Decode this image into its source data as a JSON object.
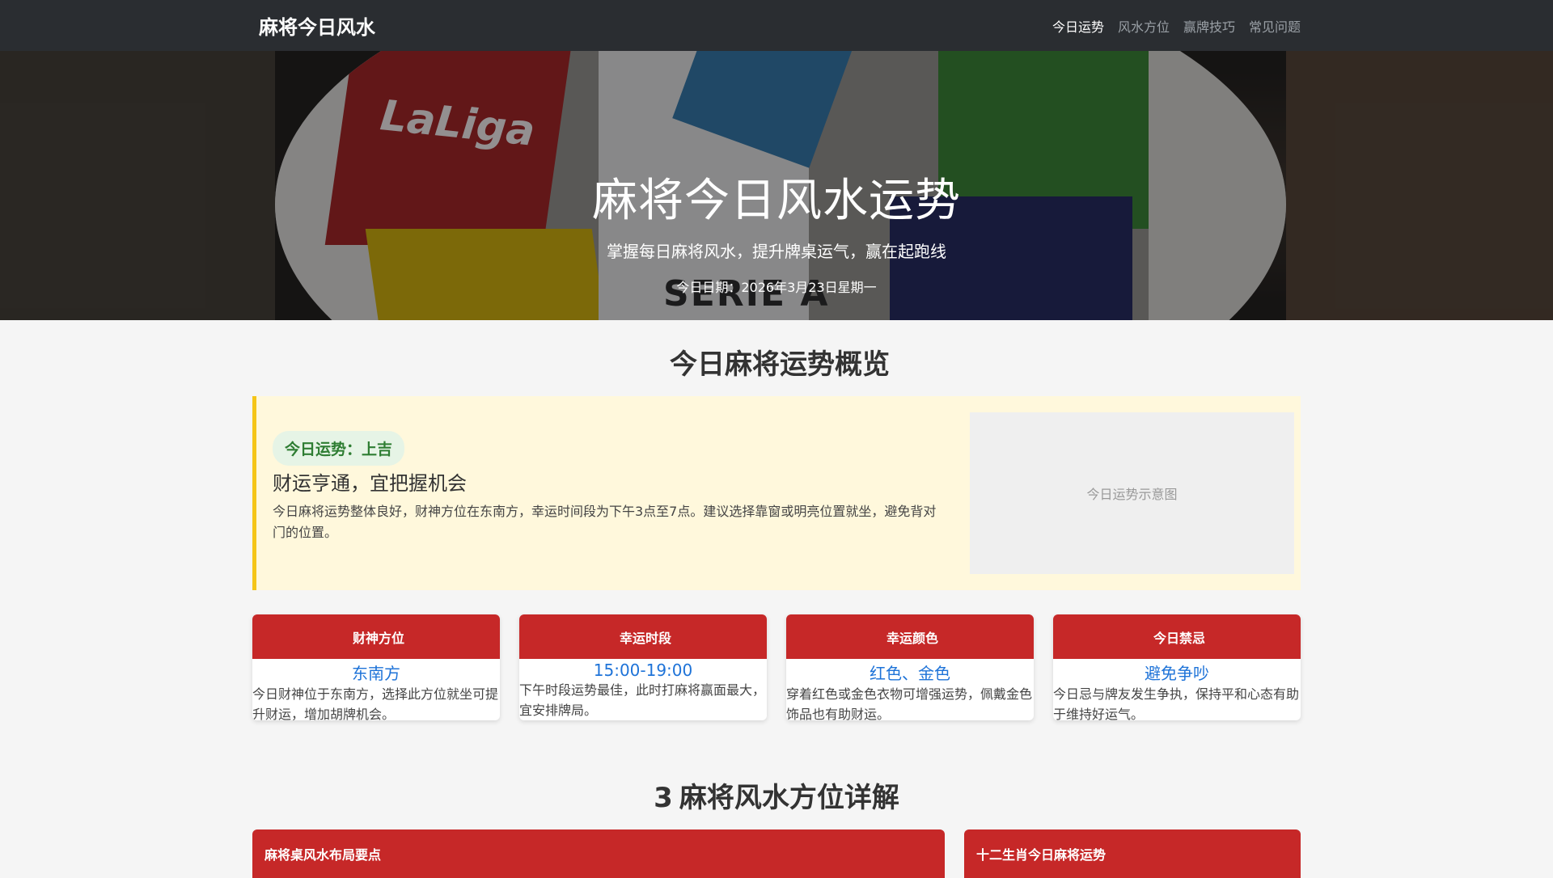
{
  "nav": {
    "brand": "麻将今日风水",
    "brand_icon": "",
    "items": [
      {
        "label": "今日运势",
        "active": true
      },
      {
        "label": "风水方位",
        "active": false
      },
      {
        "label": "赢牌技巧",
        "active": false
      },
      {
        "label": "常见问题",
        "active": false
      }
    ]
  },
  "hero": {
    "title": "麻将今日风水运势",
    "subtitle": "掌握每日麻将风水，提升牌桌运气，赢在起跑线",
    "date": "今日日期：2026年3月23日星期一",
    "background_image_text": [
      "LaLiga",
      "SERIE A"
    ]
  },
  "overview": {
    "section_icon": "",
    "section_title": "今日麻将运势概览",
    "badge": "今日运势：上吉",
    "headline": "财运亨通，宜把握机会",
    "body": "今日麻将运势整体良好，财神方位在东南方，幸运时间段为下午3点至7点。建议选择靠窗或明亮位置就坐，避免背对门的位置。",
    "image_placeholder": "今日运势示意图"
  },
  "cards": [
    {
      "icon": "",
      "title": "财神方位",
      "value": "东南方",
      "desc": "今日财神位于东南方，选择此方位就坐可提升财运，增加胡牌机会。"
    },
    {
      "icon": "",
      "title": "幸运时段",
      "value": "15:00-19:00",
      "desc": "下午时段运势最佳，此时打麻将赢面最大，宜安排牌局。"
    },
    {
      "icon": "",
      "title": "幸运颜色",
      "value": "红色、金色",
      "desc": "穿着红色或金色衣物可增强运势，佩戴金色饰品也有助财运。"
    },
    {
      "icon": "",
      "title": "今日禁忌",
      "value": "避免争吵",
      "desc": "今日忌与牌友发生争执，保持平和心态有助于维持好运气。"
    }
  ],
  "fengshui": {
    "section_icon": "3",
    "section_title": "麻将风水方位详解",
    "panel_left": "麻将桌风水布局要点",
    "panel_right": "十二生肖今日麻将运势"
  },
  "colors": {
    "nav_bg": "#2a2d31",
    "accent_red": "#c62828",
    "value_blue": "#1e73d8",
    "badge_green": "#2e7d32",
    "overview_bg": "#fff8dc",
    "overview_border": "#f5c518"
  }
}
